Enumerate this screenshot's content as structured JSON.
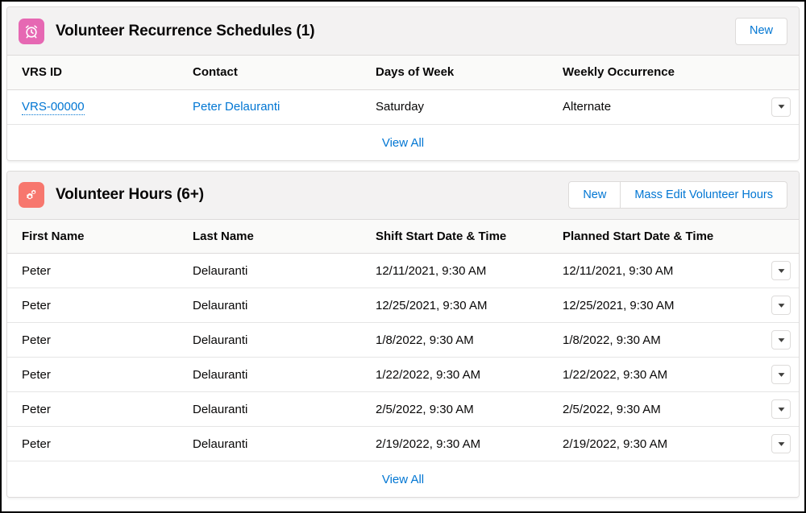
{
  "theme": {
    "link_color": "#0176d3",
    "text_color": "#080707",
    "card_header_bg": "#f3f2f2",
    "table_header_bg": "#fafaf9",
    "border_color": "#dddbda",
    "vrs_icon_color": "#e668b3",
    "hours_icon_color": "#f7776e"
  },
  "cards": [
    {
      "icon_name": "alarm-clock-icon",
      "icon_color": "#e668b3",
      "title": "Volunteer Recurrence Schedules (1)",
      "actions": [
        {
          "label": "New",
          "name": "new-vrs-button"
        }
      ],
      "columns": [
        "VRS ID",
        "Contact",
        "Days of Week",
        "Weekly Occurrence"
      ],
      "rows": [
        {
          "vrs_id": "VRS-00000",
          "contact": "Peter Delauranti",
          "days_of_week": "Saturday",
          "weekly_occurrence": "Alternate",
          "row_menu": "row-actions-caret-icon"
        }
      ],
      "footer_link": "View All"
    },
    {
      "icon_name": "gears-icon",
      "icon_color": "#f7776e",
      "title": "Volunteer Hours (6+)",
      "actions": [
        {
          "label": "New",
          "name": "new-volunteer-hours-button"
        },
        {
          "label": "Mass Edit Volunteer Hours",
          "name": "mass-edit-volunteer-hours-button"
        }
      ],
      "columns": [
        "First Name",
        "Last Name",
        "Shift Start Date & Time",
        "Planned Start Date & Time"
      ],
      "rows": [
        {
          "first_name": "Peter",
          "last_name": "Delauranti",
          "shift_start": "12/11/2021, 9:30 AM",
          "planned_start": "12/11/2021, 9:30 AM"
        },
        {
          "first_name": "Peter",
          "last_name": "Delauranti",
          "shift_start": "12/25/2021, 9:30 AM",
          "planned_start": "12/25/2021, 9:30 AM"
        },
        {
          "first_name": "Peter",
          "last_name": "Delauranti",
          "shift_start": "1/8/2022, 9:30 AM",
          "planned_start": "1/8/2022, 9:30 AM"
        },
        {
          "first_name": "Peter",
          "last_name": "Delauranti",
          "shift_start": "1/22/2022, 9:30 AM",
          "planned_start": "1/22/2022, 9:30 AM"
        },
        {
          "first_name": "Peter",
          "last_name": "Delauranti",
          "shift_start": "2/5/2022, 9:30 AM",
          "planned_start": "2/5/2022, 9:30 AM"
        },
        {
          "first_name": "Peter",
          "last_name": "Delauranti",
          "shift_start": "2/19/2022, 9:30 AM",
          "planned_start": "2/19/2022, 9:30 AM"
        }
      ],
      "footer_link": "View All"
    }
  ]
}
